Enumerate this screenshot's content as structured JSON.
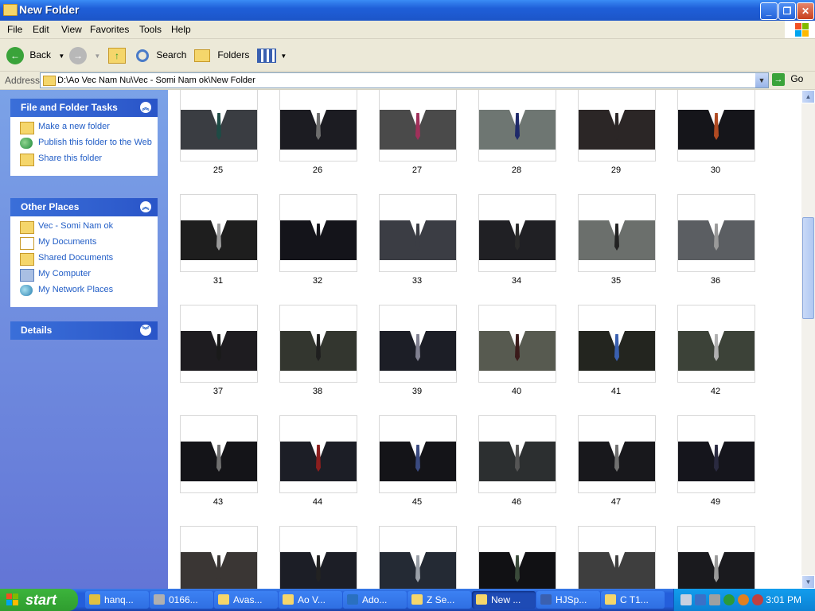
{
  "window": {
    "title": "New Folder"
  },
  "menu": [
    "File",
    "Edit",
    "View",
    "Favorites",
    "Tools",
    "Help"
  ],
  "toolbar": {
    "back": "Back",
    "search": "Search",
    "folders": "Folders"
  },
  "address": {
    "label": "Address",
    "path": "D:\\Ao Vec Nam Nu\\Vec - Somi Nam ok\\New Folder",
    "go": "Go"
  },
  "tasks_panel": {
    "title": "File and Folder Tasks",
    "items": [
      "Make a new folder",
      "Publish this folder to the Web",
      "Share this folder"
    ]
  },
  "places_panel": {
    "title": "Other Places",
    "items": [
      "Vec - Somi Nam ok",
      "My Documents",
      "Shared Documents",
      "My Computer",
      "My Network Places"
    ]
  },
  "details_panel": {
    "title": "Details"
  },
  "thumbnails": [
    {
      "label": "25",
      "suit": "#3a3d42",
      "tie": "#1e4b45"
    },
    {
      "label": "26",
      "suit": "#1c1c22",
      "tie": "#6d6d6d"
    },
    {
      "label": "27",
      "suit": "#4a4a4a",
      "tie": "#a0305a"
    },
    {
      "label": "28",
      "suit": "#6e7672",
      "tie": "#1f2a6a"
    },
    {
      "label": "29",
      "suit": "#2b2626",
      "tie": "#2b2626"
    },
    {
      "label": "30",
      "suit": "#15151a",
      "tie": "#b04a22"
    },
    {
      "label": "31",
      "suit": "#1e1e1e",
      "tie": "#9a9a9a"
    },
    {
      "label": "32",
      "suit": "#14141a",
      "tie": "#14141a"
    },
    {
      "label": "33",
      "suit": "#3b3d44",
      "tie": "#3b3d44"
    },
    {
      "label": "34",
      "suit": "#202024",
      "tie": "#2a2a2a"
    },
    {
      "label": "35",
      "suit": "#6b6f6c",
      "tie": "#222"
    },
    {
      "label": "36",
      "suit": "#5b5e62",
      "tie": "#9a9a9a"
    },
    {
      "label": "37",
      "suit": "#1e1c20",
      "tie": "#1a1a1a"
    },
    {
      "label": "38",
      "suit": "#33362f",
      "tie": "#1f1f1f"
    },
    {
      "label": "39",
      "suit": "#1c1e26",
      "tie": "#808090"
    },
    {
      "label": "40",
      "suit": "#575a50",
      "tie": "#3a1a1a"
    },
    {
      "label": "41",
      "suit": "#23251f",
      "tie": "#3a60b0"
    },
    {
      "label": "42",
      "suit": "#3c4238",
      "tie": "#b0b0b0"
    },
    {
      "label": "43",
      "suit": "#141418",
      "tie": "#707070"
    },
    {
      "label": "44",
      "suit": "#1c1e26",
      "tie": "#8b1e1e"
    },
    {
      "label": "45",
      "suit": "#141418",
      "tie": "#3a4a80"
    },
    {
      "label": "46",
      "suit": "#2c2f30",
      "tie": "#555"
    },
    {
      "label": "47",
      "suit": "#18181c",
      "tie": "#707070"
    },
    {
      "label": "49",
      "suit": "#15151c",
      "tie": "#2a2a40"
    },
    {
      "label": "",
      "suit": "#3a3634",
      "tie": "#3a3634"
    },
    {
      "label": "",
      "suit": "#1c1e26",
      "tie": "#222"
    },
    {
      "label": "",
      "suit": "#242a34",
      "tie": "#9aa0a8"
    },
    {
      "label": "",
      "suit": "#111114",
      "tie": "#3a4a3a"
    },
    {
      "label": "",
      "suit": "#3e3e3e",
      "tie": "#3e3e3e"
    },
    {
      "label": "",
      "suit": "#1a1a1e",
      "tie": "#9a9a9a"
    }
  ],
  "taskbar": {
    "start": "start",
    "items": [
      {
        "label": "hanq...",
        "color": "#e0c040"
      },
      {
        "label": "0166...",
        "color": "#b0b0b0"
      },
      {
        "label": "Avas...",
        "color": "#f5d66b"
      },
      {
        "label": "Ao V...",
        "color": "#f5d66b"
      },
      {
        "label": "Ado...",
        "color": "#2a70c0"
      },
      {
        "label": "Z Se...",
        "color": "#f5d66b"
      },
      {
        "label": "New ...",
        "color": "#f5d66b"
      },
      {
        "label": "HJSp...",
        "color": "#3a60b0"
      },
      {
        "label": "C T1...",
        "color": "#f5d66b"
      }
    ],
    "clock": "3:01 PM"
  }
}
